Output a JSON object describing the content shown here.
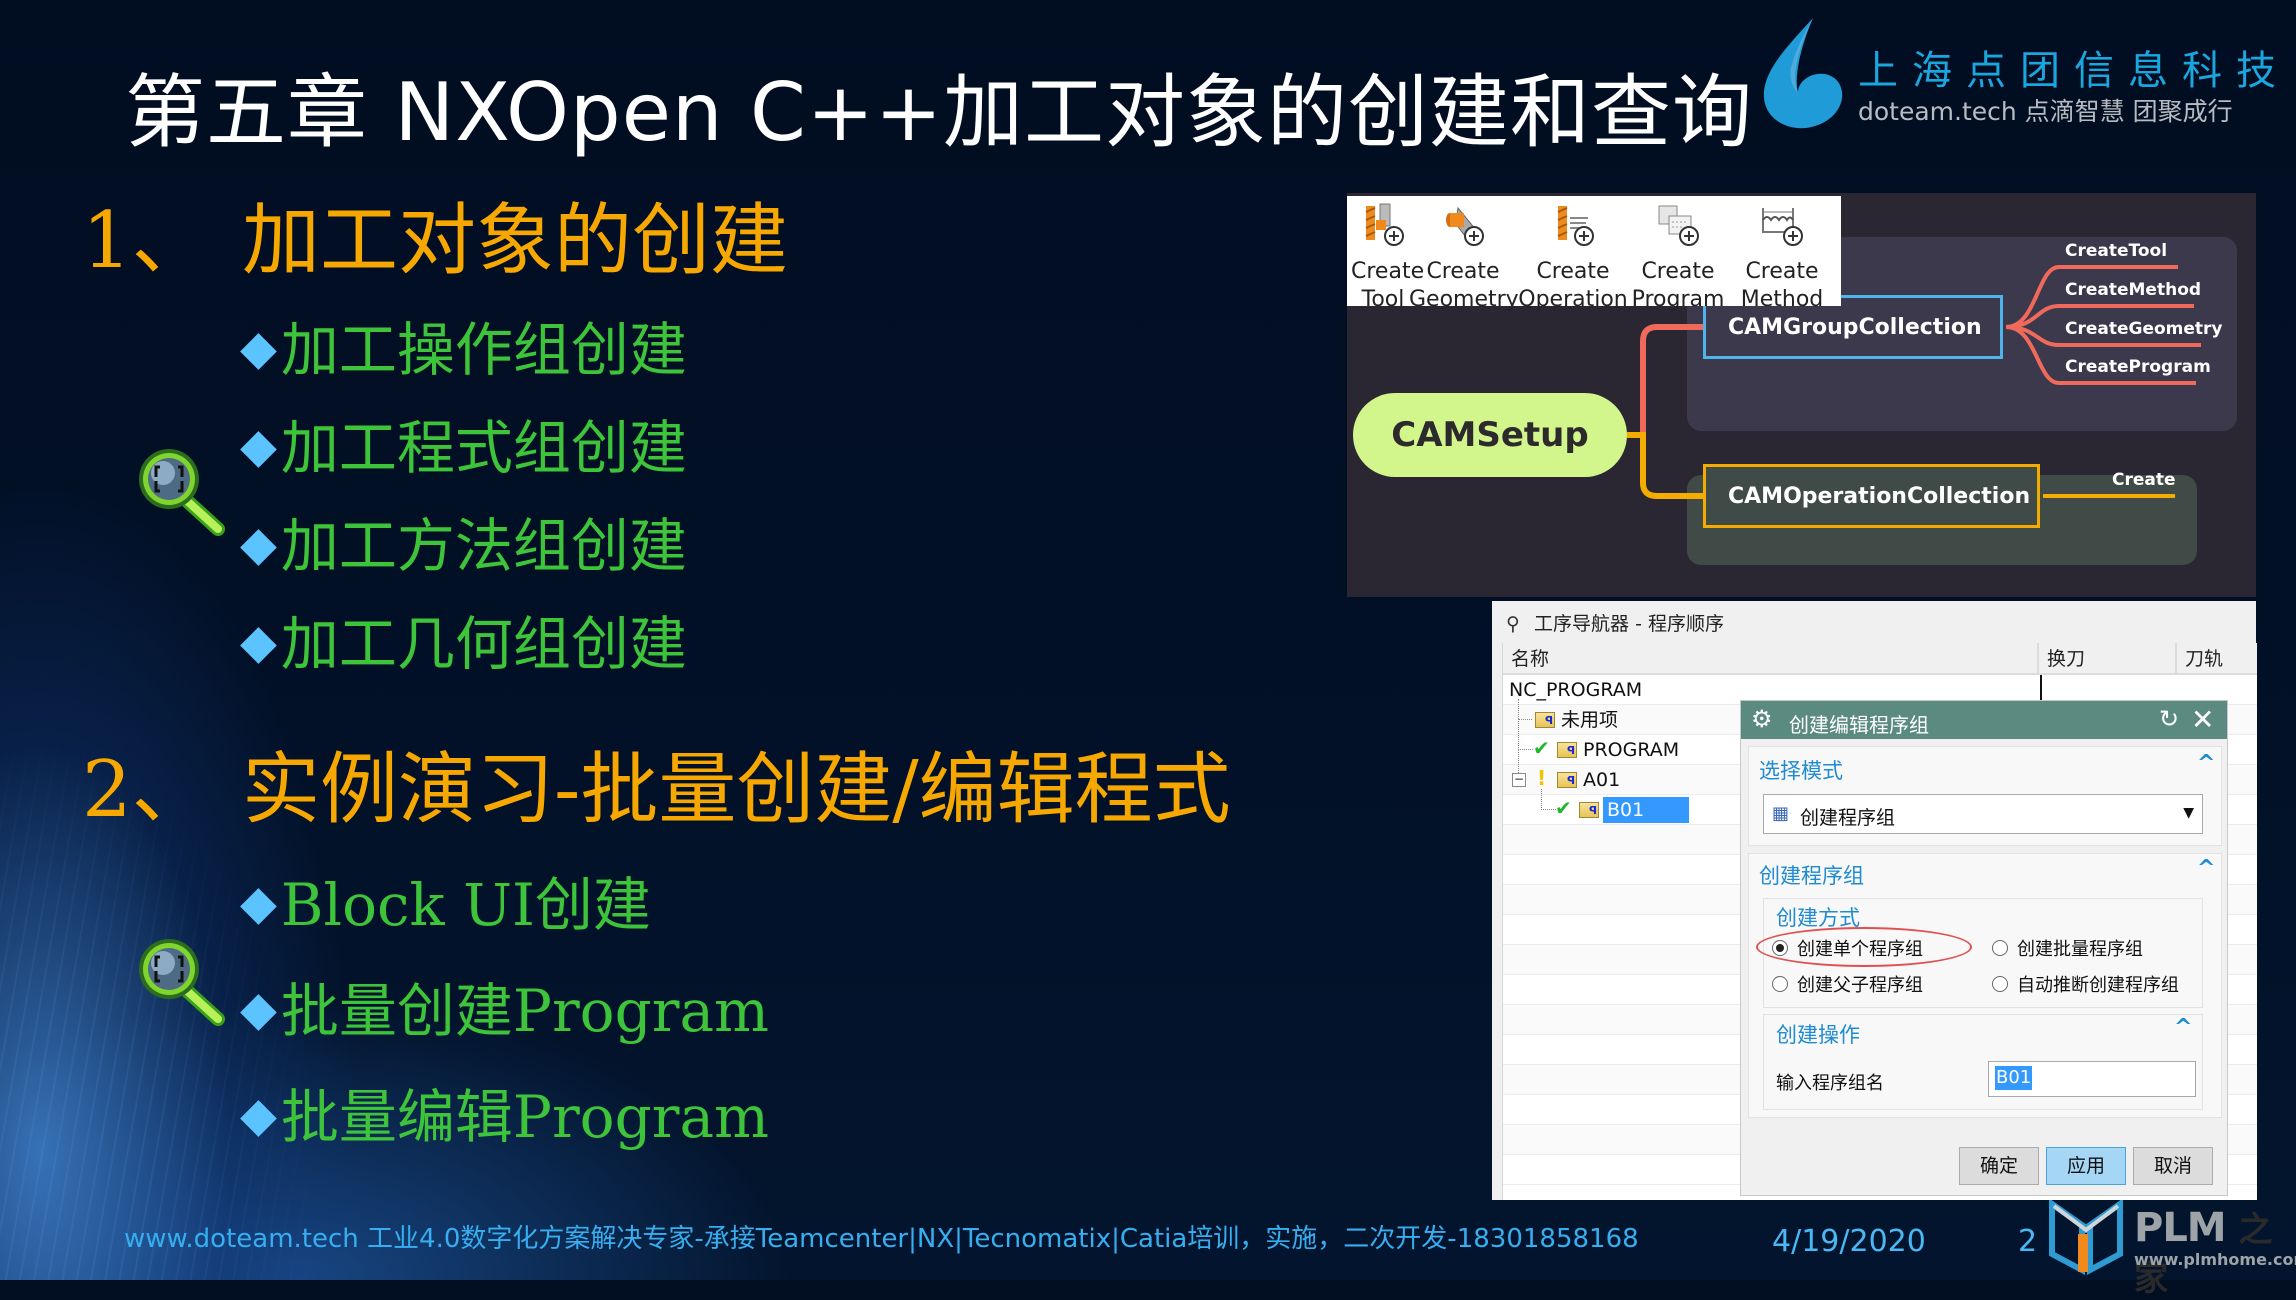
{
  "slide": {
    "title": "第五章  NXOpen C++加工对象的创建和查询",
    "logo": {
      "company_cn": "上海点团信息科技",
      "tagline": "doteam.tech  点滴智慧   团聚成行",
      "icon": "water-drop-logo-icon"
    },
    "sections": [
      {
        "number": "1、",
        "heading": "加工对象的创建",
        "bullets": [
          "加工操作组创建",
          "加工程式组创建",
          "加工方法组创建",
          "加工几何组创建"
        ]
      },
      {
        "number": "2、",
        "heading": "实例演习-批量创建/编辑程式",
        "bullets": [
          "Block UI创建",
          "批量创建Program",
          "批量编辑Program"
        ]
      }
    ],
    "bullet_glyph": "◆",
    "colors": {
      "heading": "#f7a800",
      "bullet_text": "#3ec43a",
      "bullet_marker": "#5bc3ff",
      "title": "#ffffff",
      "footer": "#36aef0"
    }
  },
  "toolbar": {
    "items": [
      {
        "line1": "Create",
        "line2": "Tool",
        "icon": "create-tool-icon"
      },
      {
        "line1": "Create",
        "line2": "Geometry",
        "icon": "create-geometry-icon"
      },
      {
        "line1": "Create",
        "line2": "Operation",
        "icon": "create-operation-icon"
      },
      {
        "line1": "Create",
        "line2": "Program",
        "icon": "create-program-icon"
      },
      {
        "line1": "Create",
        "line2": "Method",
        "icon": "create-method-icon"
      }
    ]
  },
  "mindmap": {
    "root": "CAMSetup",
    "group_node": "CAMGroupCollection",
    "group_children": [
      "CreateTool",
      "CreateMethod",
      "CreateGeometry",
      "CreateProgram"
    ],
    "operation_node": "CAMOperationCollection",
    "operation_children": [
      "Create"
    ],
    "colors": {
      "root": "#d3f68c",
      "group_border": "#4fb4ea",
      "op_border": "#f5ac00",
      "group_branch": "#f06a5c",
      "op_branch": "#f5ac00"
    }
  },
  "navigator": {
    "title": "工序导航器 - 程序顺序",
    "columns": [
      "名称",
      "换刀",
      "刀轨"
    ],
    "rows": [
      {
        "label": "NC_PROGRAM",
        "level": 0,
        "status": ""
      },
      {
        "label": "未用项",
        "level": 1,
        "status": ""
      },
      {
        "label": "PROGRAM",
        "level": 1,
        "status": "complete"
      },
      {
        "label": "A01",
        "level": 1,
        "status": "warning",
        "expanded": true
      },
      {
        "label": "B01",
        "level": 2,
        "status": "complete",
        "selected": true
      }
    ],
    "folder_glyph": "ꟼ"
  },
  "dialog": {
    "title": "创建编辑程序组",
    "select_mode": {
      "title": "选择模式",
      "selected": "创建程序组"
    },
    "create_group": {
      "title": "创建程序组",
      "method_title": "创建方式",
      "options": [
        {
          "label": "创建单个程序组",
          "checked": true
        },
        {
          "label": "创建批量程序组",
          "checked": false
        },
        {
          "label": "创建父子程序组",
          "checked": false
        },
        {
          "label": "自动推断创建程序组",
          "checked": false
        }
      ]
    },
    "create_op": {
      "title": "创建操作",
      "field_label": "输入程序组名",
      "field_value": "B01"
    },
    "buttons": {
      "ok": "确定",
      "apply": "应用",
      "cancel": "取消"
    }
  },
  "footer": {
    "text": "www.doteam.tech 工业4.0数字化方案解决专家-承接Teamcenter|NX|Tecnomatix|Catia培训，实施，二次开发-18301858168",
    "date": "4/19/2020",
    "page": "2",
    "plm_logo": {
      "brand": "PLM",
      "brand_cn": "之家",
      "url": "www.plmhome.com"
    }
  }
}
